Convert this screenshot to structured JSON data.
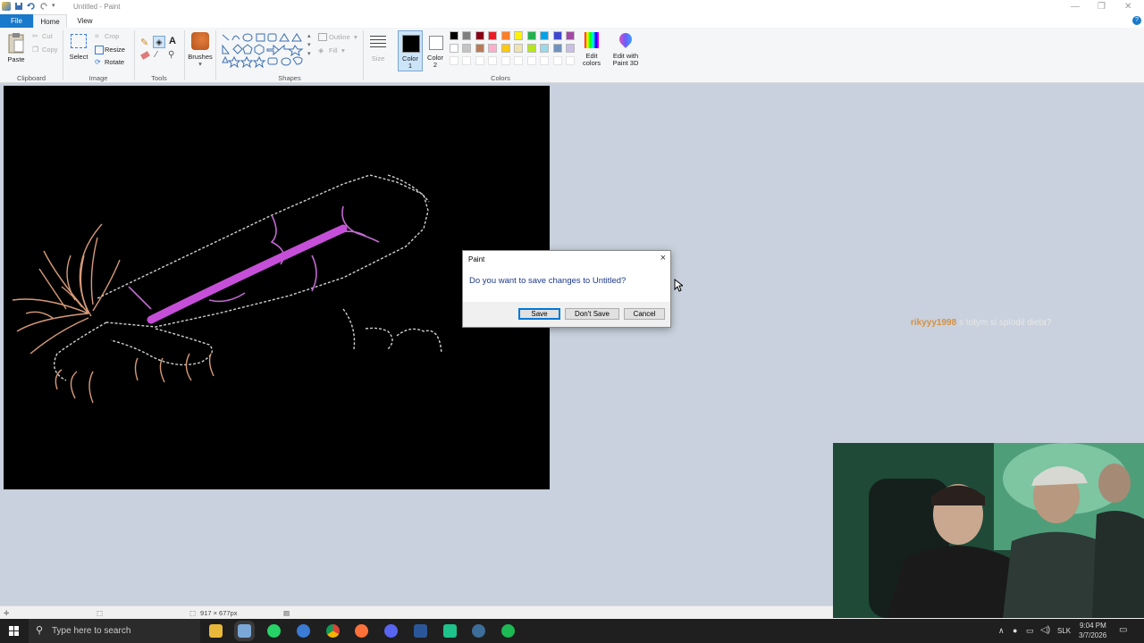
{
  "window": {
    "title": "Untitled - Paint"
  },
  "tabs": [
    {
      "label": "File"
    },
    {
      "label": "Home"
    },
    {
      "label": "View"
    }
  ],
  "ribbon": {
    "clipboard": {
      "paste": "Paste",
      "cut": "Cut",
      "copy": "Copy",
      "group": "Clipboard"
    },
    "image": {
      "select": "Select",
      "crop": "Crop",
      "resize": "Resize",
      "rotate": "Rotate",
      "group": "Image"
    },
    "tools": {
      "group": "Tools"
    },
    "brushes": {
      "label": "Brushes"
    },
    "shapes": {
      "outline": "Outline",
      "fill": "Fill",
      "group": "Shapes"
    },
    "size": {
      "label": "Size"
    },
    "color1": {
      "label": "Color",
      "num": "1"
    },
    "color2": {
      "label": "Color",
      "num": "2"
    },
    "colors": {
      "group": "Colors",
      "edit_line1": "Edit",
      "edit_line2": "colors",
      "p3d_line1": "Edit with",
      "p3d_line2": "Paint 3D"
    },
    "palette_row1": [
      "#000000",
      "#7f7f7f",
      "#880015",
      "#ed1c24",
      "#ff7f27",
      "#fff200",
      "#22b14c",
      "#00a2e8",
      "#3f48cc",
      "#a349a4"
    ],
    "palette_row2": [
      "#ffffff",
      "#c3c3c3",
      "#b97a57",
      "#ffaec9",
      "#ffc90e",
      "#efe4b0",
      "#b5e61d",
      "#99d9ea",
      "#7092be",
      "#c8bfe7"
    ]
  },
  "status": {
    "dimensions": "917 × 677px"
  },
  "dialog": {
    "title": "Paint",
    "message": "Do you want to save changes to Untitled?",
    "save": "Save",
    "dont_save": "Don't Save",
    "cancel": "Cancel"
  },
  "chat": {
    "user": "rikyyy1998",
    "text": "s totym si splodil dieta?"
  },
  "taskbar": {
    "search_placeholder": "Type here to search",
    "lang": "SLK",
    "time": "9:04 PM",
    "date": "3/7/2026",
    "apps": [
      {
        "name": "file-explorer-icon",
        "color": "#e8b83a"
      },
      {
        "name": "paint-icon",
        "color": "#7aa7d6"
      },
      {
        "name": "whatsapp-icon",
        "color": "#25d366"
      },
      {
        "name": "calendar-icon",
        "color": "#3a7bd5"
      },
      {
        "name": "chrome-icon",
        "color": "#f4b400"
      },
      {
        "name": "firefox-icon",
        "color": "#ff7139"
      },
      {
        "name": "discord-icon",
        "color": "#5865f2"
      },
      {
        "name": "word-icon",
        "color": "#2b579a"
      },
      {
        "name": "app-icon",
        "color": "#1ec28b"
      },
      {
        "name": "steam-icon",
        "color": "#3d6d99"
      },
      {
        "name": "spotify-icon",
        "color": "#1db954"
      }
    ]
  }
}
